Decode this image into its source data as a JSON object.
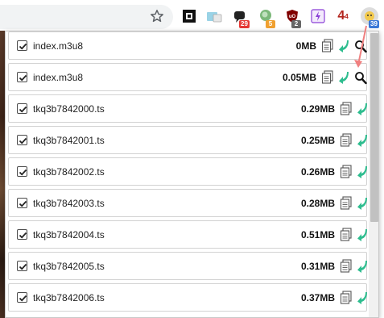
{
  "toolbar": {
    "bookmark_icon": "star-icon",
    "extensions": [
      {
        "icon": "square-logo-icon",
        "badge": ""
      },
      {
        "icon": "screen-capture-icon",
        "badge": ""
      },
      {
        "icon": "chat-bubble-icon",
        "badge": "29",
        "badge_color": "#e53935"
      },
      {
        "icon": "green-circle-icon",
        "badge": "5",
        "badge_color": "#f0a030"
      },
      {
        "icon": "ublock-shield-icon",
        "badge": "2",
        "badge_color": "#666666"
      },
      {
        "icon": "lightning-bolt-icon",
        "badge": ""
      },
      {
        "icon": "four-logo-icon",
        "label": "4",
        "sup": "4"
      },
      {
        "icon": "video-downloader-icon",
        "badge": "39",
        "badge_color": "#3b78d8"
      }
    ]
  },
  "files": [
    {
      "name": "index.m3u8",
      "size": "0MB",
      "has_search": true
    },
    {
      "name": "index.m3u8",
      "size": "0.05MB",
      "has_search": true
    },
    {
      "name": "tkq3b7842000.ts",
      "size": "0.29MB",
      "has_search": false
    },
    {
      "name": "tkq3b7842001.ts",
      "size": "0.25MB",
      "has_search": false
    },
    {
      "name": "tkq3b7842002.ts",
      "size": "0.26MB",
      "has_search": false
    },
    {
      "name": "tkq3b7842003.ts",
      "size": "0.28MB",
      "has_search": false
    },
    {
      "name": "tkq3b7842004.ts",
      "size": "0.51MB",
      "has_search": false
    },
    {
      "name": "tkq3b7842005.ts",
      "size": "0.31MB",
      "has_search": false
    },
    {
      "name": "tkq3b7842006.ts",
      "size": "0.37MB",
      "has_search": false
    }
  ],
  "colors": {
    "download_icon": "#2ebd8f",
    "annotation_arrow": "#f08080",
    "checkbox_border": "#4a4a4a"
  }
}
